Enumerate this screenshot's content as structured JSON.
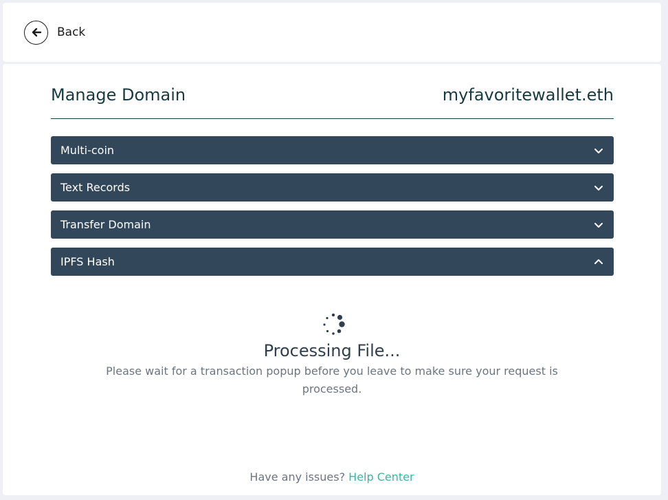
{
  "nav": {
    "back_label": "Back"
  },
  "header": {
    "title": "Manage Domain",
    "domain": "myfavoritewallet.eth"
  },
  "sections": [
    {
      "label": "Multi-coin",
      "expanded": false
    },
    {
      "label": "Text Records",
      "expanded": false
    },
    {
      "label": "Transfer Domain",
      "expanded": false
    },
    {
      "label": "IPFS Hash",
      "expanded": true
    }
  ],
  "processing": {
    "title": "Processing File...",
    "message": "Please wait for a transaction popup before you leave to make sure your request is processed."
  },
  "footer": {
    "text": "Have any issues?",
    "link": "Help Center"
  },
  "colors": {
    "accordion_bg": "#33475a",
    "link": "#3ab5a4",
    "title": "#173b40"
  },
  "icons": {
    "back": "arrow-left-icon",
    "collapsed": "chevron-down-icon",
    "expanded": "chevron-up-icon",
    "loading": "spinner-icon"
  }
}
